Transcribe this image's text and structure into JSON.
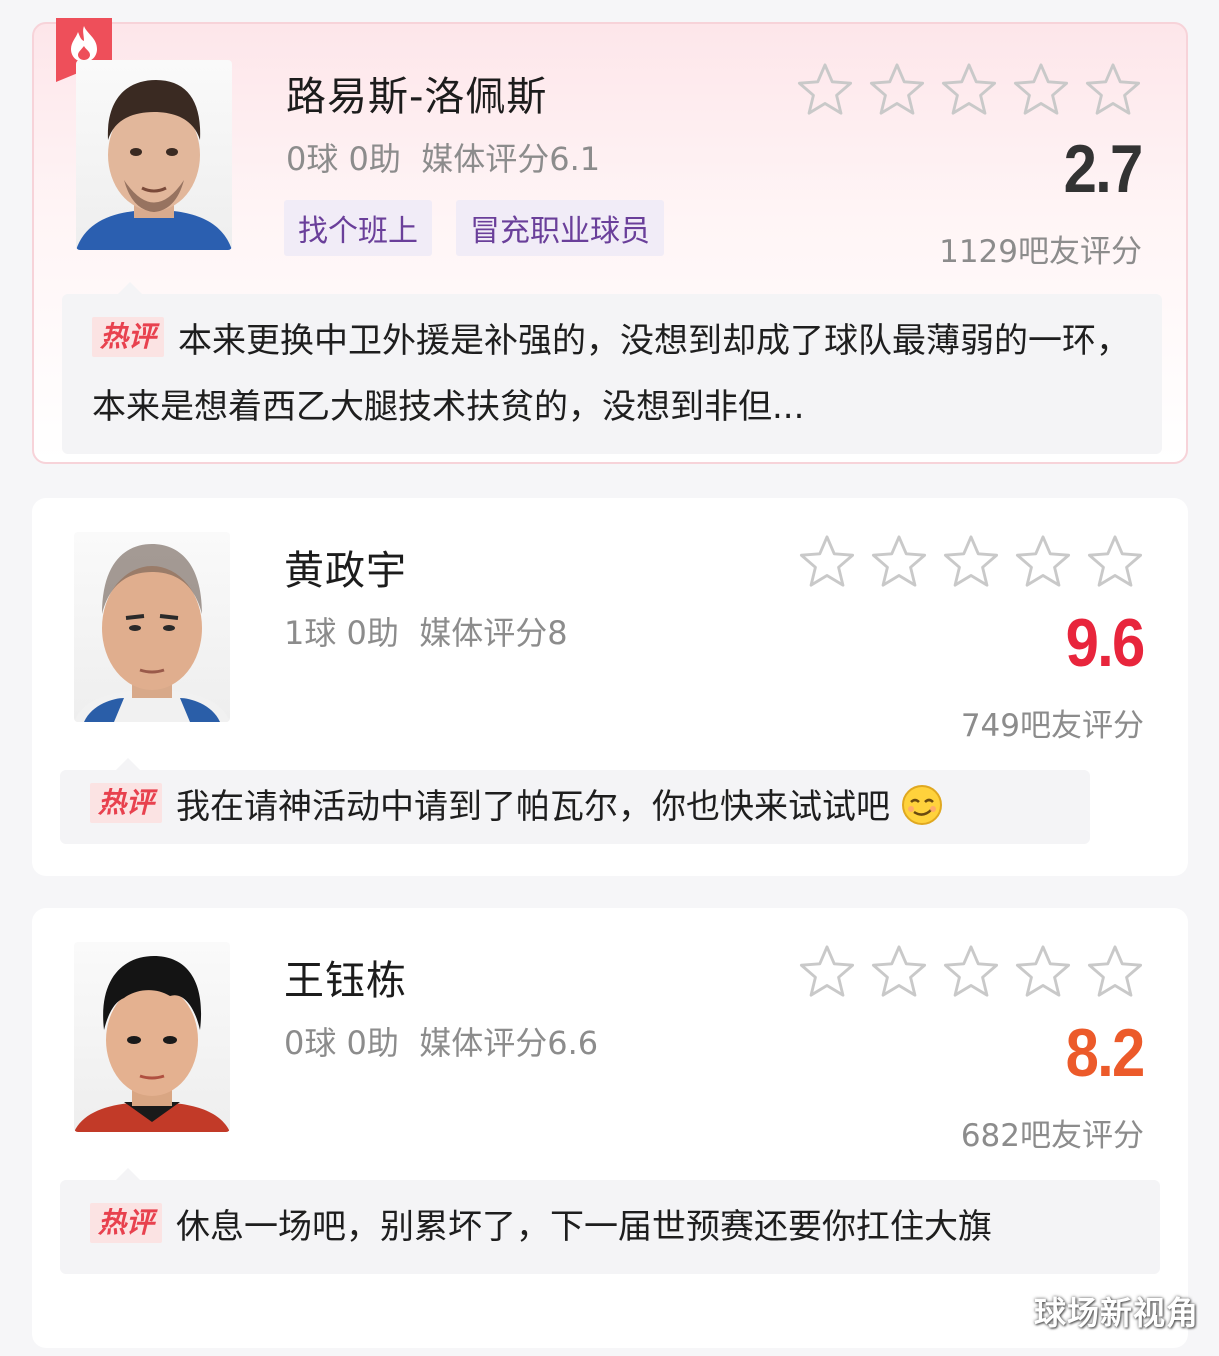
{
  "players": [
    {
      "name": "路易斯-洛佩斯",
      "stats": "0球 0助  媒体评分6.1",
      "tags": [
        "找个班上",
        "冒充职业球员"
      ],
      "score": "2.7",
      "score_color": "#333333",
      "raters": "1129吧友评分",
      "hot_label": "热评",
      "comment": "本来更换中卫外援是补强的，没想到却成了球队最薄弱的一环，本来是想着西乙大腿技术扶贫的，没想到非但..."
    },
    {
      "name": "黄政宇",
      "stats": "1球 0助  媒体评分8",
      "tags": [],
      "score": "9.6",
      "score_color": "#e8253c",
      "raters": "749吧友评分",
      "hot_label": "热评",
      "comment": "我在请神活动中请到了帕瓦尔，你也快来试试吧"
    },
    {
      "name": "王钰栋",
      "stats": "0球 0助  媒体评分6.6",
      "tags": [],
      "score": "8.2",
      "score_color": "#ec5a2a",
      "raters": "682吧友评分",
      "hot_label": "热评",
      "comment": "休息一场吧，别累坏了，下一届世预赛还要你扛住大旗"
    }
  ],
  "watermark": "球场新视角",
  "icons": {
    "hot_badge": "fire-icon",
    "star": "star-outline-icon",
    "emoji": "smirk-emoji-icon"
  }
}
